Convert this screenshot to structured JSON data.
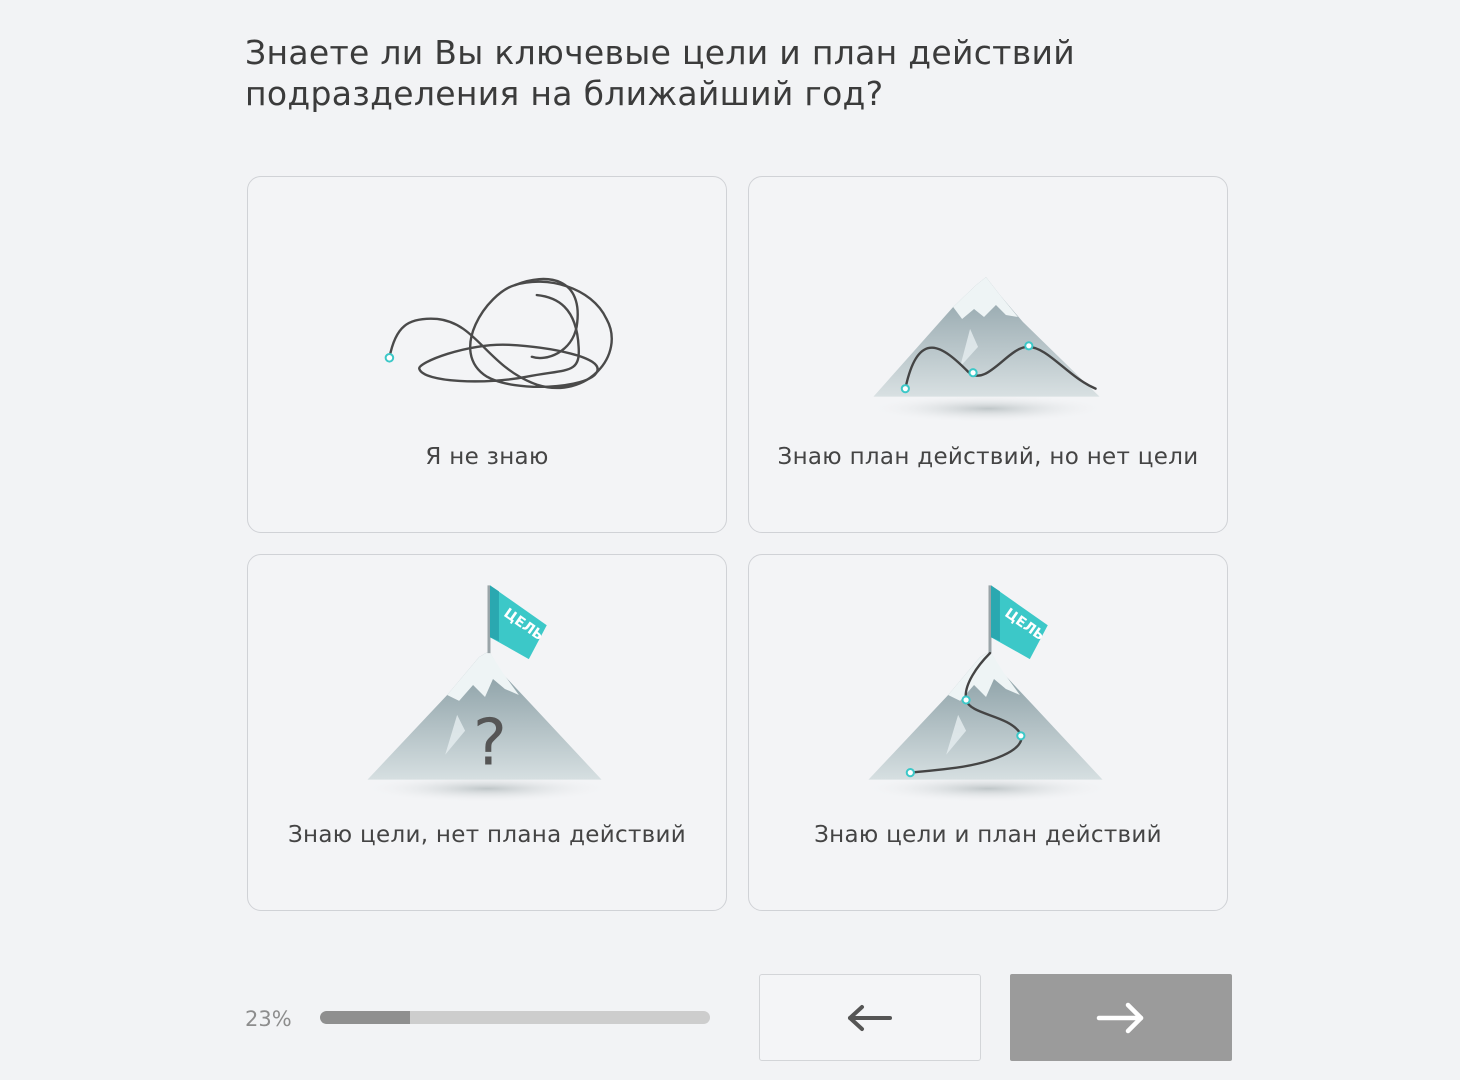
{
  "question": "Знаете ли Вы ключевые цели и план действий подразделения на ближайший год?",
  "options": [
    {
      "label": "Я не знаю",
      "icon": "tangled-line-icon"
    },
    {
      "label": "Знаю план действий, но нет цели",
      "icon": "mountain-path-icon"
    },
    {
      "label": "Знаю цели, нет плана действий",
      "icon": "mountain-flag-question-icon",
      "flag_text": "ЦЕЛЬ"
    },
    {
      "label": "Знаю цели и план действий",
      "icon": "mountain-flag-path-icon",
      "flag_text": "ЦЕЛЬ"
    }
  ],
  "progress": {
    "label": "23%",
    "value": 0.23
  },
  "nav": {
    "back_icon": "arrow-left-icon",
    "next_icon": "arrow-right-icon"
  },
  "colors": {
    "accent": "#3cc8c8",
    "next_button": "#9b9b9b",
    "progress_fill": "#8f8f8f"
  }
}
